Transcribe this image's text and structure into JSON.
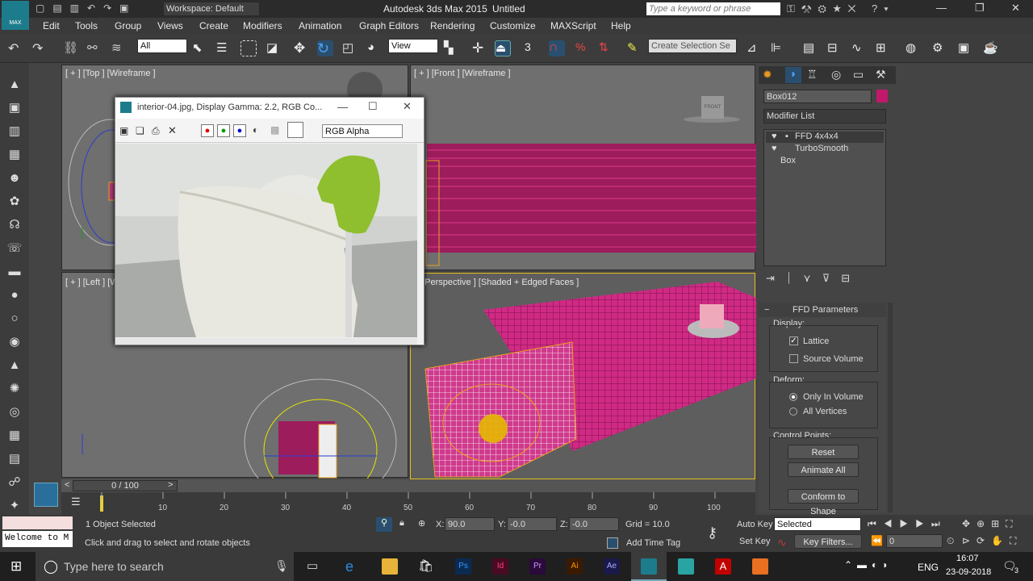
{
  "titlebar": {
    "workspace": "Workspace: Default",
    "app_title": "Autodesk 3ds Max  2015",
    "doc_title": "Untitled",
    "search_placeholder": "Type a keyword or phrase",
    "logo": "MAX"
  },
  "menus": [
    "Edit",
    "Tools",
    "Group",
    "Views",
    "Create",
    "Modifiers",
    "Animation",
    "Graph Editors",
    "Rendering",
    "Customize",
    "MAXScript",
    "Help"
  ],
  "toolbar": {
    "filter": "All",
    "refcoord": "View",
    "snap_num": "3",
    "selset_placeholder": "Create Selection Se"
  },
  "viewports": {
    "top": "[ + ] [Top ] [Wireframe ]",
    "front": "[ + ] [Front ] [Wireframe ]",
    "left": "[ + ] [Left ] [W",
    "persp": "] [Perspective ] [Shaded + Edged Faces ]",
    "viewcube": "FRONT"
  },
  "image_window": {
    "title": "interior-04.jpg, Display Gamma: 2.2, RGB Co...",
    "channel": "RGB Alpha"
  },
  "command_panel": {
    "object_name": "Box012",
    "modifier_list": "Modifier List",
    "stack": [
      "FFD 4x4x4",
      "TurboSmooth",
      "Box"
    ],
    "ffd_title": "FFD Parameters",
    "display_label": "Display:",
    "lattice": "Lattice",
    "source_volume": "Source Volume",
    "deform_label": "Deform:",
    "only_in_volume": "Only In Volume",
    "all_vertices": "All Vertices",
    "control_points": "Control Points:",
    "reset": "Reset",
    "animate_all": "Animate All",
    "conform": "Conform to Shape",
    "accent": "#c2186b"
  },
  "timeline": {
    "frame": "0 / 100",
    "ticks": [
      "10",
      "20",
      "30",
      "40",
      "50",
      "60",
      "70",
      "80",
      "90",
      "100"
    ]
  },
  "status": {
    "maxscript": "Welcome to M",
    "selected": "1 Object Selected",
    "prompt": "Click and drag to select and rotate objects",
    "x_label": "X:",
    "x_val": "90.0",
    "y_label": "Y:",
    "y_val": "-0.0",
    "z_label": "Z:",
    "z_val": "-0.0",
    "grid": "Grid = 10.0",
    "add_time_tag": "Add Time Tag",
    "auto_key": "Auto Key",
    "set_key": "Set Key",
    "key_mode": "Selected",
    "key_filters": "Key Filters...",
    "frame_field": "0"
  },
  "taskbar": {
    "search": "Type here to search",
    "lang": "ENG",
    "time": "16:07",
    "date": "23-09-2018",
    "notif": "3"
  }
}
